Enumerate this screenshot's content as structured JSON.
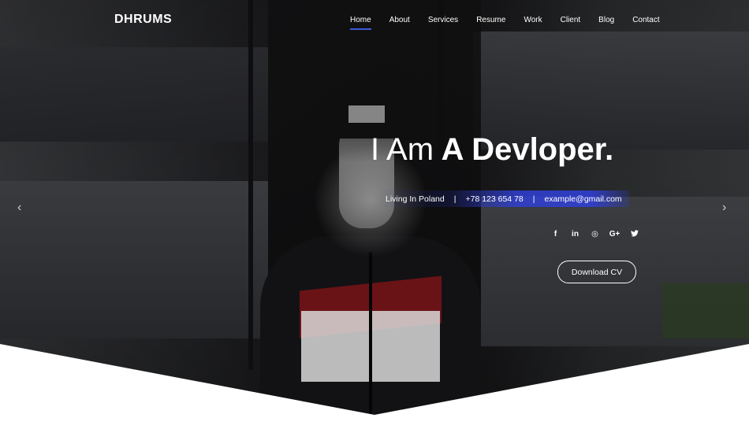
{
  "brand": {
    "name": "DHRUMS"
  },
  "nav": {
    "items": [
      {
        "label": "Home",
        "active": true
      },
      {
        "label": "About",
        "active": false
      },
      {
        "label": "Services",
        "active": false
      },
      {
        "label": "Resume",
        "active": false
      },
      {
        "label": "Work",
        "active": false
      },
      {
        "label": "Client",
        "active": false
      },
      {
        "label": "Blog",
        "active": false
      },
      {
        "label": "Contact",
        "active": false
      }
    ]
  },
  "hero": {
    "headline_light": "I Am",
    "headline_bold": "A Devloper.",
    "location": "Living In Poland",
    "separator": "|",
    "phone": "+78 123 654 78",
    "email": "example@gmail.com",
    "cta_label": "Download CV"
  },
  "social": {
    "icons": [
      {
        "name": "facebook-icon",
        "glyph": "f"
      },
      {
        "name": "linkedin-icon",
        "glyph": "in"
      },
      {
        "name": "dribbble-icon",
        "glyph": "◎"
      },
      {
        "name": "google-plus-icon",
        "glyph": "G+"
      },
      {
        "name": "twitter-icon",
        "glyph": "🐦"
      }
    ]
  },
  "carousel": {
    "prev_glyph": "‹",
    "next_glyph": "›"
  },
  "colors": {
    "accent": "#3b5bdb",
    "info_bar": "#303fd2",
    "text": "#ffffff"
  }
}
